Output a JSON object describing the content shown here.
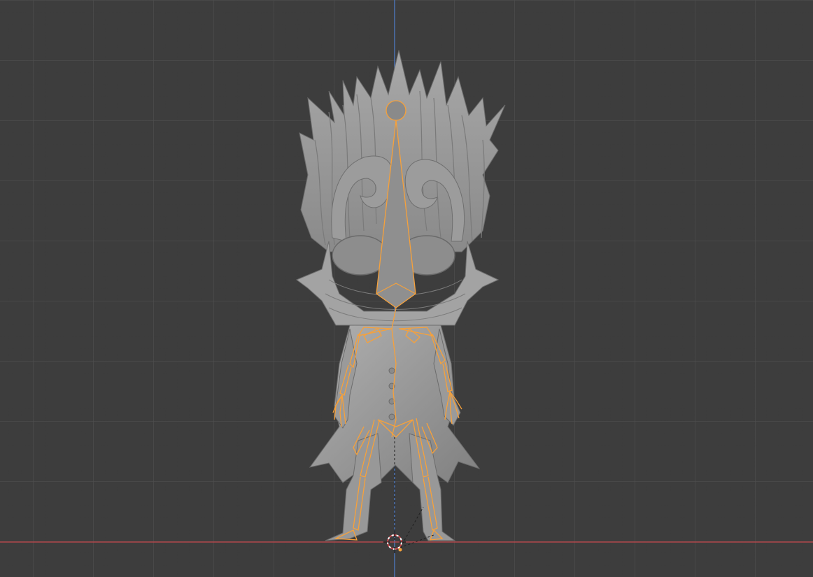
{
  "viewport": {
    "grid_color": "#505050",
    "background_color": "#3d3d3d",
    "x_axis_color": "#c6474b",
    "z_axis_color": "#4a79c9",
    "selection_color": "#f7a13a",
    "mesh_color": "#9a9a9a",
    "mesh_shadow_color": "#6e6e6e",
    "objects": {
      "character_mesh": "character-mesh",
      "armature": "armature",
      "origin": "3d-cursor-icon"
    }
  }
}
